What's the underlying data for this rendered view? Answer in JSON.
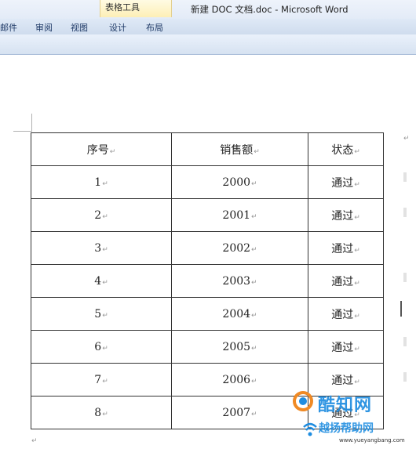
{
  "ribbon": {
    "contextual_group": "表格工具",
    "window_title": "新建 DOC 文档.doc - Microsoft Word",
    "tabs": [
      "邮件",
      "审阅",
      "视图",
      "设计",
      "布局"
    ]
  },
  "table": {
    "header": [
      "序号",
      "销售额",
      "状态"
    ],
    "rows": [
      [
        "1",
        "2000",
        "通过"
      ],
      [
        "2",
        "2001",
        "通过"
      ],
      [
        "3",
        "2002",
        "通过"
      ],
      [
        "4",
        "2003",
        "通过"
      ],
      [
        "5",
        "2004",
        "通过"
      ],
      [
        "6",
        "2005",
        "通过"
      ],
      [
        "7",
        "2006",
        "通过"
      ],
      [
        "8",
        "2007",
        "通过"
      ]
    ]
  },
  "marks": {
    "cell_end": "↵",
    "row_end": "↵",
    "paragraph_end": "↵"
  },
  "watermark": {
    "brand_top": "酷知网",
    "brand_bottom": "越扬帮助网",
    "url": "www.yueyangbang.com",
    "color": "#1f8de0"
  }
}
